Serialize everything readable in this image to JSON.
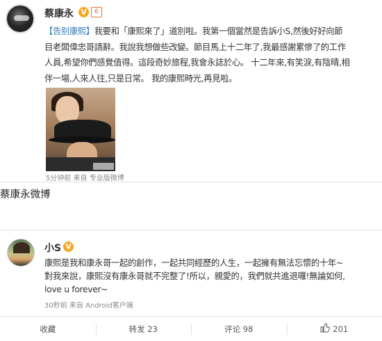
{
  "post1": {
    "username": "蔡康永",
    "verified_badge": "V",
    "level_badge": "6",
    "tag": "【告别康熙】",
    "body_lines": [
      "我要和「康熙來了」道別啦。我第一個當然是告訴小S,然後好好向節",
      "目老闆偉忠哥請辭。我說我想做些改變。節目馬上十二年了,我最感謝累慘了的工作",
      "人員,希望你們感覺值得。這段奇妙旅程,我會永誌於心。 十二年來,有笑淚,有陰晴,相",
      "伴一場,人來人往,只是日常。 我的康熙時光,再見啦。"
    ],
    "meta": "5分钟前 来自 专业版微博"
  },
  "caption": "蔡康永微博",
  "post2": {
    "username": "小S",
    "verified_badge": "V",
    "body_lines": [
      "康熙是我和康永哥一起的創作，一起共同經歷的人生，一起擁有無法忘懷的十年~",
      "對我來說，康熙沒有康永哥就不完整了!所以，親愛的，我們就共進退囉!無論如何,",
      "love u forever~"
    ],
    "meta": "30秒前 来自 Android客户端"
  },
  "actions": {
    "favorite": "收藏",
    "repost": "转发 23",
    "comment": "评论 98",
    "like_icon": "thumbs-up-icon",
    "like": "201"
  },
  "colors": {
    "verified": "#f5a623",
    "tag": "#3377b5",
    "level": "#e57126"
  }
}
